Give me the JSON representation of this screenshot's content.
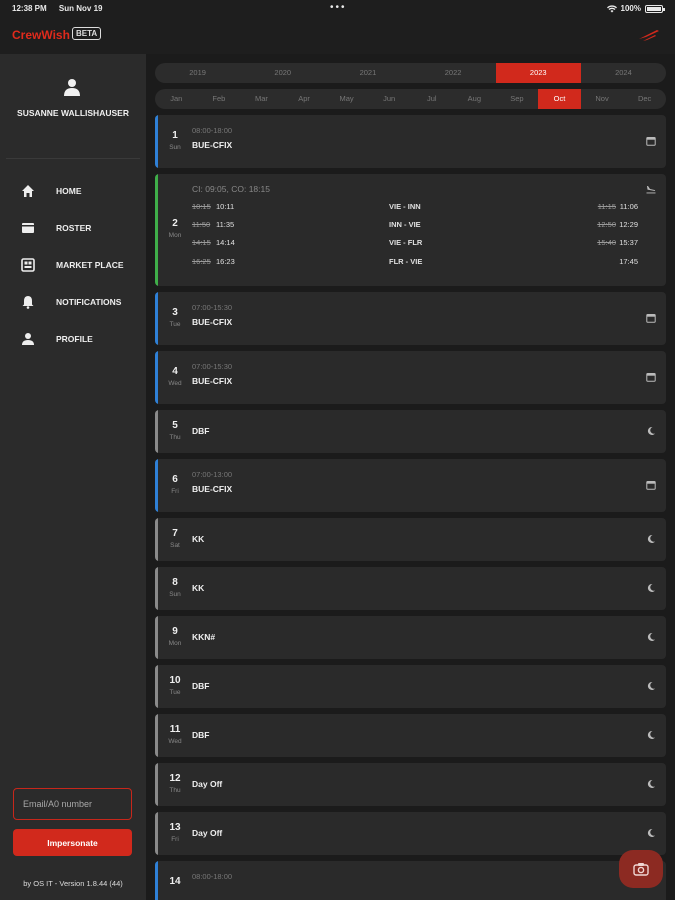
{
  "status_bar": {
    "time": "12:38 PM",
    "date": "Sun Nov 19",
    "dots": "•••",
    "battery": "100%"
  },
  "header": {
    "brand_crew": "Crew",
    "brand_wish": "Wish",
    "badge": "BETA"
  },
  "sidebar": {
    "user_name": "SUSANNE WALLISHAUSER",
    "items": [
      {
        "label": "HOME",
        "icon": "home-icon"
      },
      {
        "label": "ROSTER",
        "icon": "roster-icon"
      },
      {
        "label": "MARKET PLACE",
        "icon": "store-icon"
      },
      {
        "label": "NOTIFICATIONS",
        "icon": "bell-icon"
      },
      {
        "label": "PROFILE",
        "icon": "person-icon"
      }
    ],
    "email_placeholder": "Email/A0 number",
    "impersonate_label": "Impersonate",
    "version": "by OS IT - Version 1.8.44 (44)"
  },
  "years": [
    "2019",
    "2020",
    "2021",
    "2022",
    "2023",
    "2024"
  ],
  "selected_year": "2023",
  "months": [
    "Jan",
    "Feb",
    "Mar",
    "Apr",
    "May",
    "Jun",
    "Jul",
    "Aug",
    "Sep",
    "Oct",
    "Nov",
    "Dec"
  ],
  "selected_month": "Oct",
  "colors": {
    "accent": "#d1291c",
    "blue": "#2f80d6",
    "green": "#3fae49",
    "grey": "#8a8a8a"
  },
  "days": [
    {
      "num": "1",
      "dow": "Sun",
      "time": "08:00-18:00",
      "code": "BUE-CFIX",
      "accent": "blue",
      "icon": "calendar-icon"
    },
    {
      "num": "2",
      "dow": "Mon",
      "flight": true,
      "header": "CI: 09:05, CO: 18:15",
      "accent": "green",
      "icon": "landing-icon",
      "legs": [
        {
          "dep_plan": "10:15",
          "dep_act": "10:11",
          "route": "VIE  -  INN",
          "arr_plan": "11:15",
          "arr_act": "11:06"
        },
        {
          "dep_plan": "11:50",
          "dep_act": "11:35",
          "route": "INN  -  VIE",
          "arr_plan": "12:50",
          "arr_act": "12:29"
        },
        {
          "dep_plan": "14:15",
          "dep_act": "14:14",
          "route": "VIE  -  FLR",
          "arr_plan": "15:40",
          "arr_act": "15:37"
        },
        {
          "dep_plan": "16:25",
          "dep_act": "16:23",
          "route": "FLR  -  VIE",
          "arr_plan": "",
          "arr_act": "17:45"
        }
      ]
    },
    {
      "num": "3",
      "dow": "Tue",
      "time": "07:00-15:30",
      "code": "BUE-CFIX",
      "accent": "blue",
      "icon": "calendar-icon"
    },
    {
      "num": "4",
      "dow": "Wed",
      "time": "07:00-15:30",
      "code": "BUE-CFIX",
      "accent": "blue",
      "icon": "calendar-icon"
    },
    {
      "num": "5",
      "dow": "Thu",
      "time": "",
      "code": "DBF",
      "accent": "grey",
      "icon": "moon-icon"
    },
    {
      "num": "6",
      "dow": "Fri",
      "time": "07:00-13:00",
      "code": "BUE-CFIX",
      "accent": "blue",
      "icon": "calendar-icon"
    },
    {
      "num": "7",
      "dow": "Sat",
      "time": "",
      "code": "KK",
      "accent": "grey",
      "icon": "moon-icon"
    },
    {
      "num": "8",
      "dow": "Sun",
      "time": "",
      "code": "KK",
      "accent": "grey",
      "icon": "moon-icon"
    },
    {
      "num": "9",
      "dow": "Mon",
      "time": "",
      "code": "KKN#",
      "accent": "grey",
      "icon": "moon-icon"
    },
    {
      "num": "10",
      "dow": "Tue",
      "time": "",
      "code": "DBF",
      "accent": "grey",
      "icon": "moon-icon"
    },
    {
      "num": "11",
      "dow": "Wed",
      "time": "",
      "code": "DBF",
      "accent": "grey",
      "icon": "moon-icon"
    },
    {
      "num": "12",
      "dow": "Thu",
      "time": "",
      "code": "Day Off",
      "accent": "grey",
      "icon": "moon-icon"
    },
    {
      "num": "13",
      "dow": "Fri",
      "time": "",
      "code": "Day Off",
      "accent": "grey",
      "icon": "moon-icon"
    },
    {
      "num": "14",
      "dow": "",
      "time": "08:00-18:00",
      "code": "",
      "accent": "blue",
      "icon": ""
    }
  ]
}
